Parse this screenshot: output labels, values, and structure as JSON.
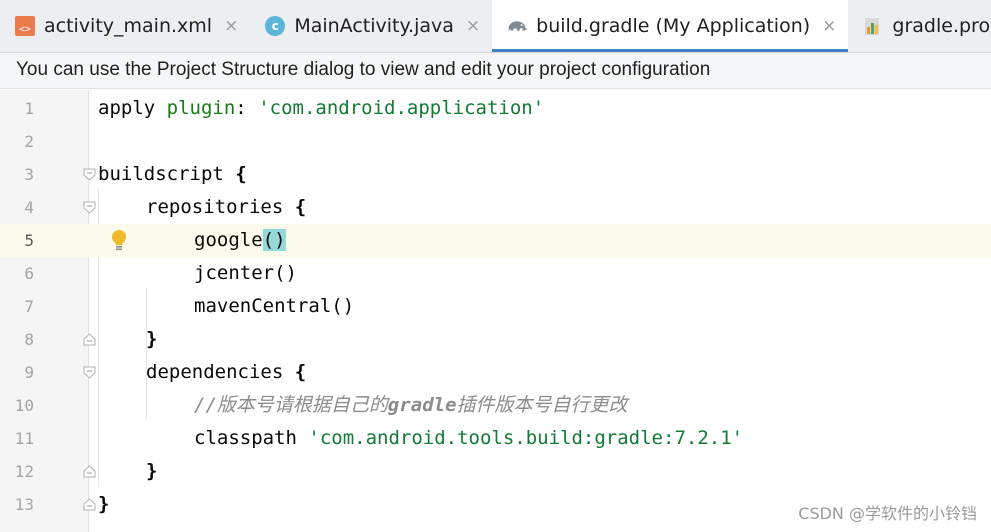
{
  "tabs": [
    {
      "label": "activity_main.xml",
      "icon": "xml-file-icon",
      "closable": true,
      "active": false
    },
    {
      "label": "MainActivity.java",
      "icon": "java-class-icon",
      "closable": true,
      "active": false
    },
    {
      "label": "build.gradle (My Application)",
      "icon": "gradle-elephant-icon",
      "closable": true,
      "active": true
    },
    {
      "label": "gradle.properties",
      "icon": "properties-file-icon",
      "closable": false,
      "active": false
    }
  ],
  "tab_close_glyph": "×",
  "banner": {
    "text": "You can use the Project Structure dialog to view and edit your project configuration"
  },
  "editor": {
    "current_line": 5,
    "lines": [
      {
        "n": "1"
      },
      {
        "n": "2"
      },
      {
        "n": "3"
      },
      {
        "n": "4"
      },
      {
        "n": "5"
      },
      {
        "n": "6"
      },
      {
        "n": "7"
      },
      {
        "n": "8"
      },
      {
        "n": "9"
      },
      {
        "n": "10"
      },
      {
        "n": "11"
      },
      {
        "n": "12"
      },
      {
        "n": "13"
      }
    ],
    "code": {
      "l1_kw": "apply",
      "l1_plugin": "plugin",
      "l1_colon": ": ",
      "l1_str": "'com.android.application'",
      "l3": "buildscript ",
      "l3_brace": "{",
      "l4": "repositories ",
      "l4_brace": "{",
      "l5_fn": "google",
      "l5_paren": "()",
      "l6": "jcenter()",
      "l7": "mavenCentral()",
      "l8": "}",
      "l9": "dependencies ",
      "l9_brace": "{",
      "l10_slash": "//",
      "l10_a": "版本号请根据自己的",
      "l10_b": "gradle",
      "l10_c": "插件版本号自行更改",
      "l11_kw": "classpath ",
      "l11_str": "'com.android.tools.build:gradle:7.2.1'",
      "l12": "}",
      "l13": "}"
    }
  },
  "colors": {
    "accent_tab_underline": "#4083c9",
    "string_green": "#117a35",
    "keyword_green": "#177a17",
    "current_line_bg": "#fcfaed",
    "paren_match_bg": "#93d9d9",
    "bulb_yellow": "#f0b929"
  },
  "watermark": "CSDN @学软件的小铃铛"
}
